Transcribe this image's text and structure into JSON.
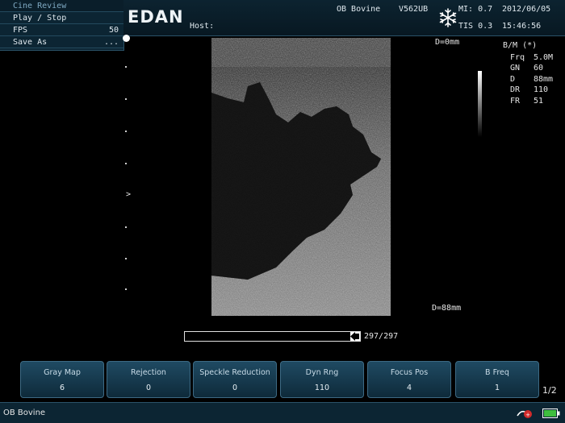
{
  "cine_menu": {
    "title": "Cine Review",
    "play_stop": "Play / Stop",
    "fps_label": "FPS",
    "fps_value": "50",
    "save_as": "Save As",
    "save_as_more": "..."
  },
  "header": {
    "logo": "EDAN",
    "host_label": "Host:",
    "preset": "OB Bovine",
    "probe": "V562UB",
    "mi": "MI: 0.7",
    "tis": "TIS 0.3",
    "date": "2012/06/05",
    "time": "15:46:56"
  },
  "scale": {
    "focus_marker": ">"
  },
  "image": {
    "depth_top": "D=0mm",
    "depth_bottom": "D=88mm"
  },
  "params": {
    "mode": "B/M (*)",
    "items": [
      {
        "label": "Frq",
        "value": "5.0M"
      },
      {
        "label": "GN",
        "value": "60"
      },
      {
        "label": "D",
        "value": "88mm"
      },
      {
        "label": "DR",
        "value": "110"
      },
      {
        "label": "FR",
        "value": "51"
      }
    ]
  },
  "cine": {
    "counter": "297/297",
    "progress": 1.0
  },
  "softkeys": [
    {
      "label": "Gray Map",
      "value": "6"
    },
    {
      "label": "Rejection",
      "value": "0"
    },
    {
      "label": "Speckle Reduction",
      "value": "0"
    },
    {
      "label": "Dyn Rng",
      "value": "110"
    },
    {
      "label": "Focus Pos",
      "value": "4"
    },
    {
      "label": "B Freq",
      "value": "1"
    }
  ],
  "page_indicator": "1/2",
  "status": {
    "text": "OB Bovine"
  },
  "icons": {
    "freeze": "snowflake-icon",
    "probe_status": "probe-connect-icon",
    "battery": "battery-icon"
  },
  "colors": {
    "panel": "#0c2533",
    "border": "#2a5268",
    "key_top": "#1f4a62",
    "key_bottom": "#0e2a3a",
    "battery_fill": "#3fbf3f"
  }
}
